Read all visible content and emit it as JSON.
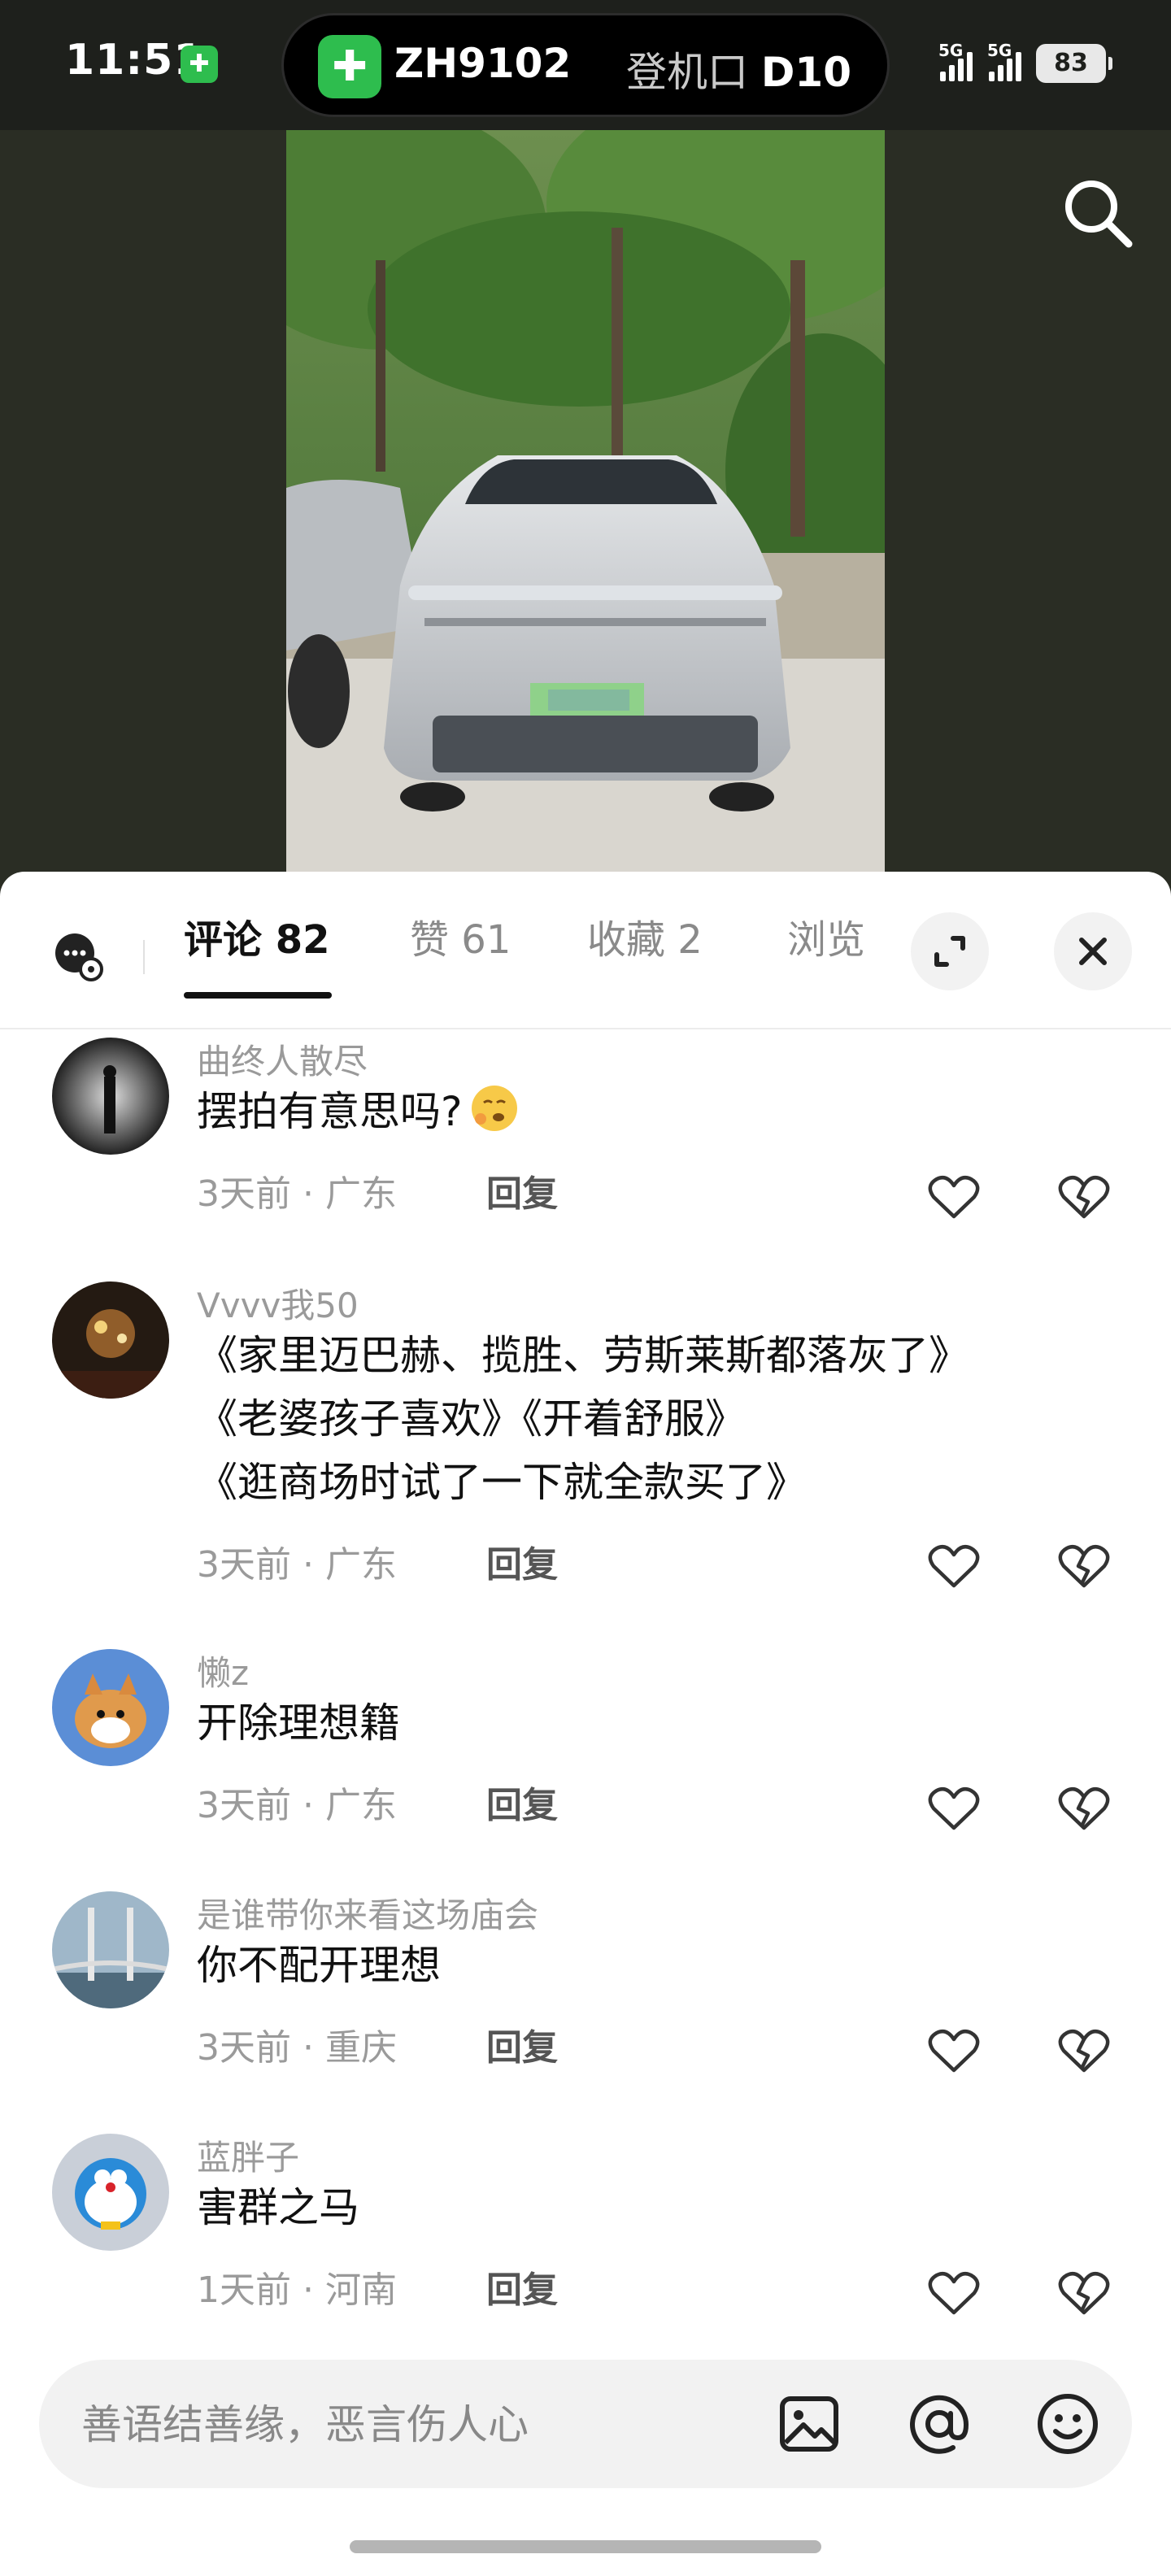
{
  "status_bar": {
    "time": "11:51",
    "island": {
      "flight": "ZH9102",
      "gate_label": "登机口",
      "gate": "D10"
    },
    "signal_1": "5G",
    "signal_2": "5G",
    "battery": "83"
  },
  "tabs": [
    {
      "label": "评论",
      "count": "82"
    },
    {
      "label": "赞",
      "count": "61"
    },
    {
      "label": "收藏",
      "count": "2"
    },
    {
      "label": "浏览"
    }
  ],
  "comments": [
    {
      "user": "曲终人散尽",
      "text": [
        "摆拍有意思吗?"
      ],
      "emoji": "thinking-face-icon",
      "time": "3天前",
      "location": "广东",
      "reply": "回复"
    },
    {
      "user": "Vvvv我50",
      "text": [
        "《家里迈巴赫、揽胜、劳斯莱斯都落灰了》",
        "《老婆孩子喜欢》《开着舒服》",
        "《逛商场时试了一下就全款买了》"
      ],
      "time": "3天前",
      "location": "广东",
      "reply": "回复"
    },
    {
      "user": "懒z",
      "text": [
        "开除理想籍"
      ],
      "time": "3天前",
      "location": "广东",
      "reply": "回复"
    },
    {
      "user": "是谁带你来看这场庙会",
      "text": [
        "你不配开理想"
      ],
      "time": "3天前",
      "location": "重庆",
      "reply": "回复"
    },
    {
      "user": "蓝胖子",
      "text": [
        "害群之马"
      ],
      "time": "1天前",
      "location": "河南",
      "reply": "回复"
    }
  ],
  "input": {
    "placeholder": "善语结善缘，恶言伤人心"
  },
  "colors": {
    "accent_green": "#2ebd4e",
    "sheet_bg": "#ffffff",
    "muted_text": "#9a9a9a"
  }
}
